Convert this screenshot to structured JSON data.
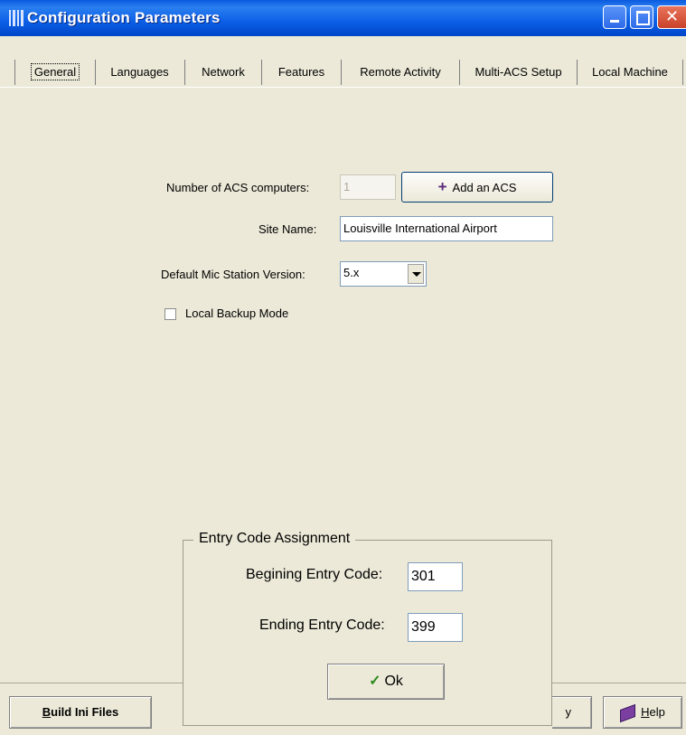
{
  "window": {
    "title": "Configuration Parameters"
  },
  "tabs": [
    {
      "label": "General"
    },
    {
      "label": "Languages"
    },
    {
      "label": "Network"
    },
    {
      "label": "Features"
    },
    {
      "label": "Remote Activity"
    },
    {
      "label": "Multi-ACS Setup"
    },
    {
      "label": "Local Machine"
    }
  ],
  "general": {
    "acs_count_label": "Number of ACS computers:",
    "acs_count_value": "1",
    "add_acs_label": "Add an ACS",
    "add_acs_icon": "+",
    "site_name_label": "Site Name:",
    "site_name_value": "Louisville International Airport",
    "mic_version_label": "Default Mic Station Version:",
    "mic_version_value": "5.x",
    "local_backup_label": "Local Backup Mode",
    "local_backup_checked": false
  },
  "entry_code": {
    "title": "Entry Code Assignment",
    "begin_label": "Begining Entry Code:",
    "begin_value": "301",
    "end_label": "Ending Entry Code:",
    "end_value": "399",
    "ok_label": "Ok",
    "ok_icon": "✓"
  },
  "bottom": {
    "build_label": "Build Ini Files",
    "build_mnemonic": "B",
    "apply_partial": "y",
    "help_label": "Help",
    "help_mnemonic": "H",
    "help_icon": "book-icon"
  }
}
